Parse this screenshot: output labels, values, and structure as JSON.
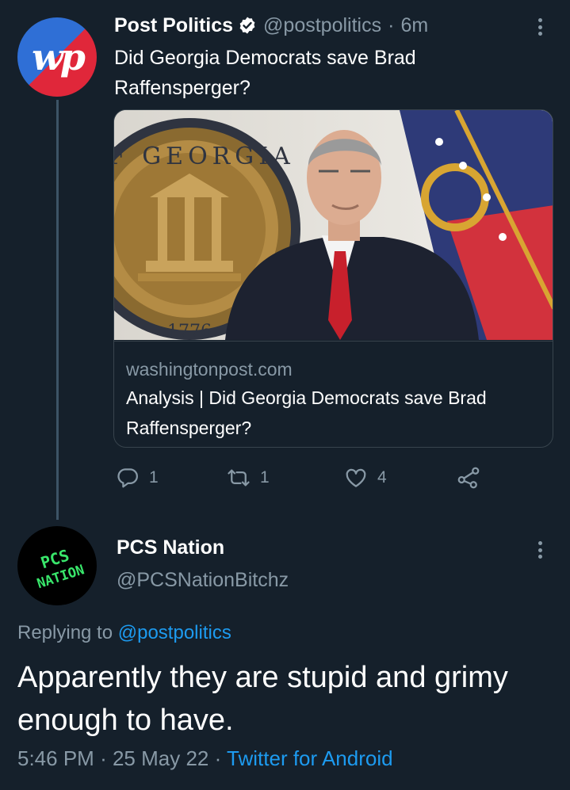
{
  "tweet1": {
    "avatar_text": "wp",
    "author_name": "Post Politics",
    "handle": "@postpolitics",
    "separator": "·",
    "time": "6m",
    "text": "Did Georgia Democrats save Brad Raffensperger?",
    "card": {
      "domain": "washingtonpost.com",
      "title": "Analysis | Did Georgia Democrats save Brad Raffensperger?",
      "seal_text": "OF GEORGIA",
      "seal_year": "1776"
    },
    "actions": {
      "replies": "1",
      "retweets": "1",
      "likes": "4"
    }
  },
  "tweet2": {
    "avatar_line1": "PCS",
    "avatar_line2": "NATION",
    "author_name": "PCS Nation",
    "handle": "@PCSNationBitchz",
    "replying_prefix": "Replying to",
    "replying_to": "@postpolitics",
    "text": "Apparently they are stupid and grimy enough to have.",
    "time": "5:46 PM",
    "sep1": "·",
    "date": "25 May 22",
    "sep2": "·",
    "client": "Twitter for Android"
  },
  "colors": {
    "background": "#15202b",
    "muted": "#8899a6",
    "link": "#1d9bf0",
    "border": "#38444d",
    "verified": "#ffffff",
    "pcs_green": "#39e66b"
  },
  "icons": [
    "reply-icon",
    "retweet-icon",
    "like-icon",
    "share-icon",
    "verified-icon",
    "more-icon"
  ]
}
